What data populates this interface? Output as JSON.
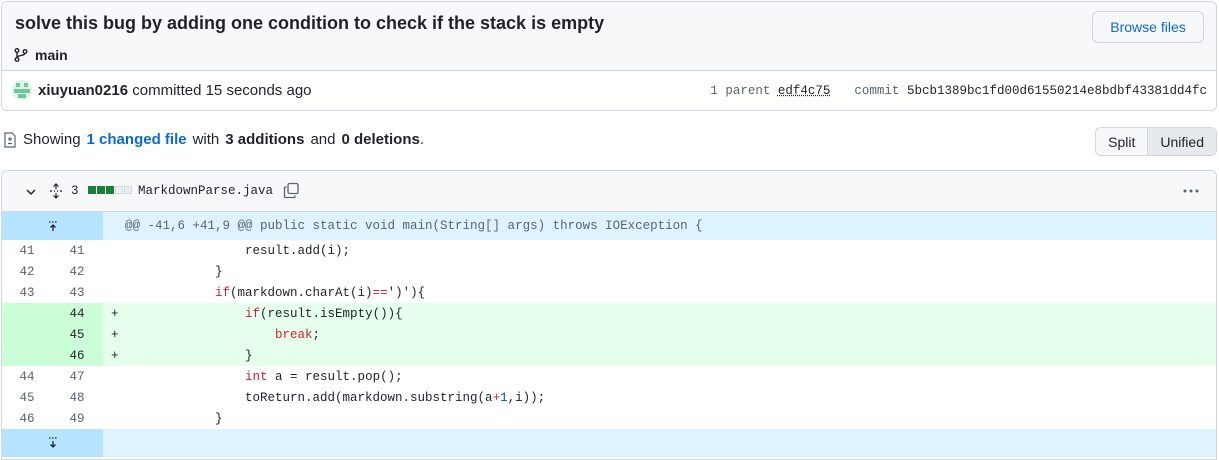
{
  "commit": {
    "title": "solve this bug by adding one condition to check if the stack is empty",
    "branch": "main",
    "browse_label": "Browse files",
    "author": "xiuyuan0216",
    "action": "committed 15 seconds ago",
    "parent_label": "1 parent",
    "parent_hash": "edf4c75",
    "commit_label": "commit",
    "commit_hash": "5bcb1389bc1fd00d61550214e8bdbf43381dd4fc"
  },
  "summary": {
    "showing": "Showing",
    "changed_link": "1 changed file",
    "with": "with",
    "additions": "3 additions",
    "and": "and",
    "deletions": "0 deletions",
    "period": ".",
    "split_label": "Split",
    "unified_label": "Unified"
  },
  "file": {
    "change_count": "3",
    "name": "MarkdownParse.java",
    "diffstat_colors": [
      "#1a7f37",
      "#1a7f37",
      "#1a7f37",
      "#d0d7de",
      "#d0d7de"
    ]
  },
  "diff": {
    "hunk_header": "@@ -41,6 +41,9 @@ public static void main(String[] args) throws IOException {",
    "lines": [
      {
        "old": "41",
        "new": "41",
        "sign": "",
        "code": "                result.add(i);",
        "type": "context"
      },
      {
        "old": "42",
        "new": "42",
        "sign": "",
        "code": "            }",
        "type": "context"
      },
      {
        "old": "43",
        "new": "43",
        "sign": "",
        "code": "            if(markdown.charAt(i)==')'){",
        "type": "context"
      },
      {
        "old": "",
        "new": "44",
        "sign": "+",
        "code": "                if(result.isEmpty()){",
        "type": "added"
      },
      {
        "old": "",
        "new": "45",
        "sign": "+",
        "code": "                    break;",
        "type": "added"
      },
      {
        "old": "",
        "new": "46",
        "sign": "+",
        "code": "                }",
        "type": "added"
      },
      {
        "old": "44",
        "new": "47",
        "sign": "",
        "code": "                int a = result.pop();",
        "type": "context"
      },
      {
        "old": "45",
        "new": "48",
        "sign": "",
        "code": "                toReturn.add(markdown.substring(a+1,i));",
        "type": "context"
      },
      {
        "old": "46",
        "new": "49",
        "sign": "",
        "code": "            }",
        "type": "context"
      }
    ]
  }
}
